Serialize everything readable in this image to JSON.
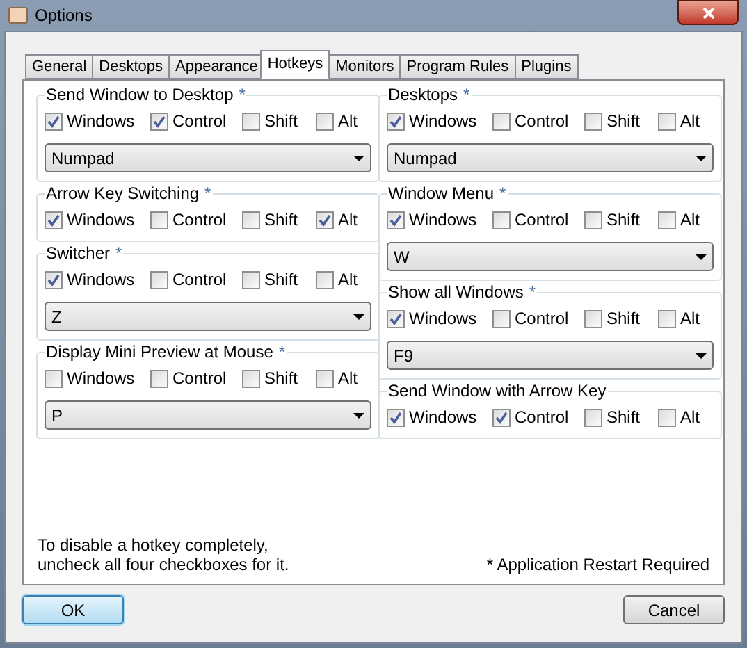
{
  "window": {
    "title": "Options"
  },
  "tabs": [
    {
      "label": "General",
      "selected": false
    },
    {
      "label": "Desktops",
      "selected": false
    },
    {
      "label": "Appearance",
      "selected": false
    },
    {
      "label": "Hotkeys",
      "selected": true
    },
    {
      "label": "Monitors",
      "selected": false
    },
    {
      "label": "Program Rules",
      "selected": false
    },
    {
      "label": "Plugins",
      "selected": false
    }
  ],
  "columns": [
    {
      "groups": [
        {
          "title": "Send Window to Desktop",
          "asterisk": "*",
          "checkboxes": [
            {
              "label": "Windows",
              "checked": true
            },
            {
              "label": "Control",
              "checked": true
            },
            {
              "label": "Shift",
              "checked": false
            },
            {
              "label": "Alt",
              "checked": false
            }
          ],
          "dropdown": "Numpad"
        },
        {
          "title": "Arrow Key Switching",
          "asterisk": "*",
          "checkboxes": [
            {
              "label": "Windows",
              "checked": true
            },
            {
              "label": "Control",
              "checked": false
            },
            {
              "label": "Shift",
              "checked": false
            },
            {
              "label": "Alt",
              "checked": true
            }
          ]
        },
        {
          "title": "Switcher",
          "asterisk": "*",
          "checkboxes": [
            {
              "label": "Windows",
              "checked": true
            },
            {
              "label": "Control",
              "checked": false
            },
            {
              "label": "Shift",
              "checked": false
            },
            {
              "label": "Alt",
              "checked": false
            }
          ],
          "dropdown": "Z"
        },
        {
          "title": "Display Mini Preview at Mouse",
          "asterisk": "*",
          "checkboxes": [
            {
              "label": "Windows",
              "checked": false
            },
            {
              "label": "Control",
              "checked": false
            },
            {
              "label": "Shift",
              "checked": false
            },
            {
              "label": "Alt",
              "checked": false
            }
          ],
          "dropdown": "P"
        }
      ]
    },
    {
      "groups": [
        {
          "title": "Desktops",
          "asterisk": "*",
          "checkboxes": [
            {
              "label": "Windows",
              "checked": true
            },
            {
              "label": "Control",
              "checked": false
            },
            {
              "label": "Shift",
              "checked": false
            },
            {
              "label": "Alt",
              "checked": false
            }
          ],
          "dropdown": "Numpad"
        },
        {
          "title": "Window Menu",
          "asterisk": "*",
          "checkboxes": [
            {
              "label": "Windows",
              "checked": true
            },
            {
              "label": "Control",
              "checked": false
            },
            {
              "label": "Shift",
              "checked": false
            },
            {
              "label": "Alt",
              "checked": false
            }
          ],
          "dropdown": "W"
        },
        {
          "title": "Show all Windows",
          "asterisk": "*",
          "checkboxes": [
            {
              "label": "Windows",
              "checked": true
            },
            {
              "label": "Control",
              "checked": false
            },
            {
              "label": "Shift",
              "checked": false
            },
            {
              "label": "Alt",
              "checked": false
            }
          ],
          "dropdown": "F9"
        },
        {
          "title": "Send Window with Arrow Key",
          "checkboxes": [
            {
              "label": "Windows",
              "checked": true
            },
            {
              "label": "Control",
              "checked": true
            },
            {
              "label": "Shift",
              "checked": false
            },
            {
              "label": "Alt",
              "checked": false
            }
          ]
        }
      ]
    }
  ],
  "hint": [
    "To disable a hotkey completely,",
    "uncheck all four checkboxes for it."
  ],
  "restart_note": "* Application Restart Required",
  "buttons": {
    "ok": "OK",
    "cancel": "Cancel"
  }
}
